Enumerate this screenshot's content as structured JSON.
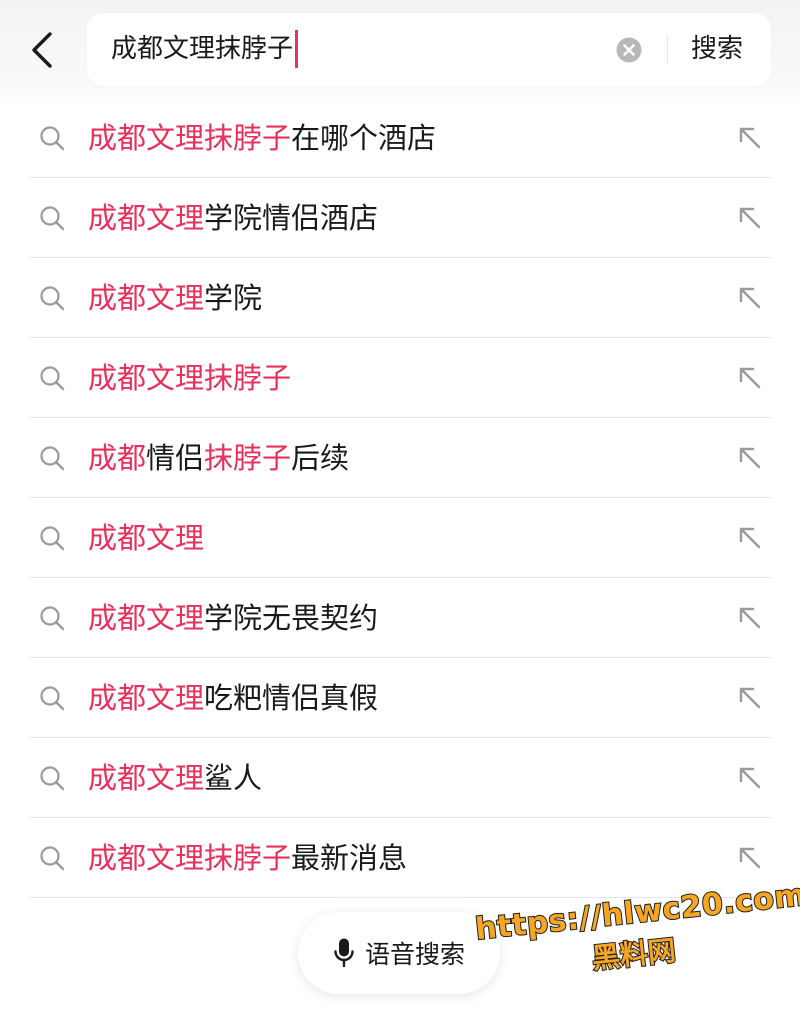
{
  "colors": {
    "highlight": "#e8305a",
    "text": "#1a1a1a",
    "icon": "#9a9a9a",
    "divider": "#e6e6e6",
    "watermark": "#f6a623"
  },
  "header": {
    "back_icon": "chevron-left-icon",
    "search": {
      "value": "成都文理抹脖子",
      "clear_icon": "clear-circle-icon"
    },
    "submit_label": "搜索"
  },
  "suggestions": [
    {
      "highlight": "成都文理抹脖子",
      "rest": "在哪个酒店"
    },
    {
      "highlight": "成都文理",
      "rest": "学院情侣酒店"
    },
    {
      "highlight": "成都文理",
      "rest": "学院"
    },
    {
      "highlight": "成都文理抹脖子",
      "rest": ""
    },
    {
      "highlight": "成都",
      "mid": "情侣",
      "highlight2": "抹脖子",
      "rest": "后续"
    },
    {
      "highlight": "成都文理",
      "rest": ""
    },
    {
      "highlight": "成都文理",
      "rest": "学院无畏契约"
    },
    {
      "highlight": "成都文理",
      "rest": "吃粑情侣真假"
    },
    {
      "highlight": "成都文理",
      "rest": "鲨人"
    },
    {
      "highlight": "成都文理抹脖子",
      "rest": "最新消息"
    }
  ],
  "voice_search": {
    "label": "语音搜索",
    "icon": "microphone-icon"
  },
  "watermark": {
    "url": "https://hlwc20.com",
    "name": "黑料网"
  }
}
